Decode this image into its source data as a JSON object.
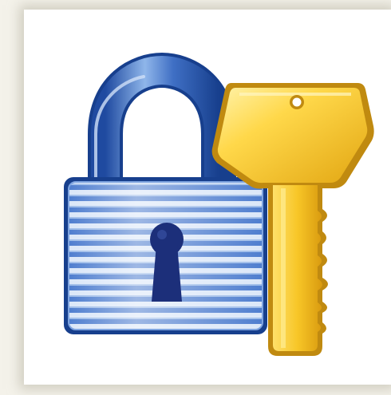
{
  "image": {
    "subject": "padlock-and-key",
    "icons": [
      "padlock-icon",
      "key-icon"
    ],
    "colors": {
      "page_background": "#f4f2ea",
      "panel_background": "#ffffff",
      "lock_blue_dark": "#2a56a8",
      "lock_blue_light": "#d8e6f7",
      "keyhole": "#1c2f7a",
      "key_gold": "#f2c01a",
      "key_gold_light": "#ffe680",
      "key_outline": "#c08a10"
    }
  }
}
